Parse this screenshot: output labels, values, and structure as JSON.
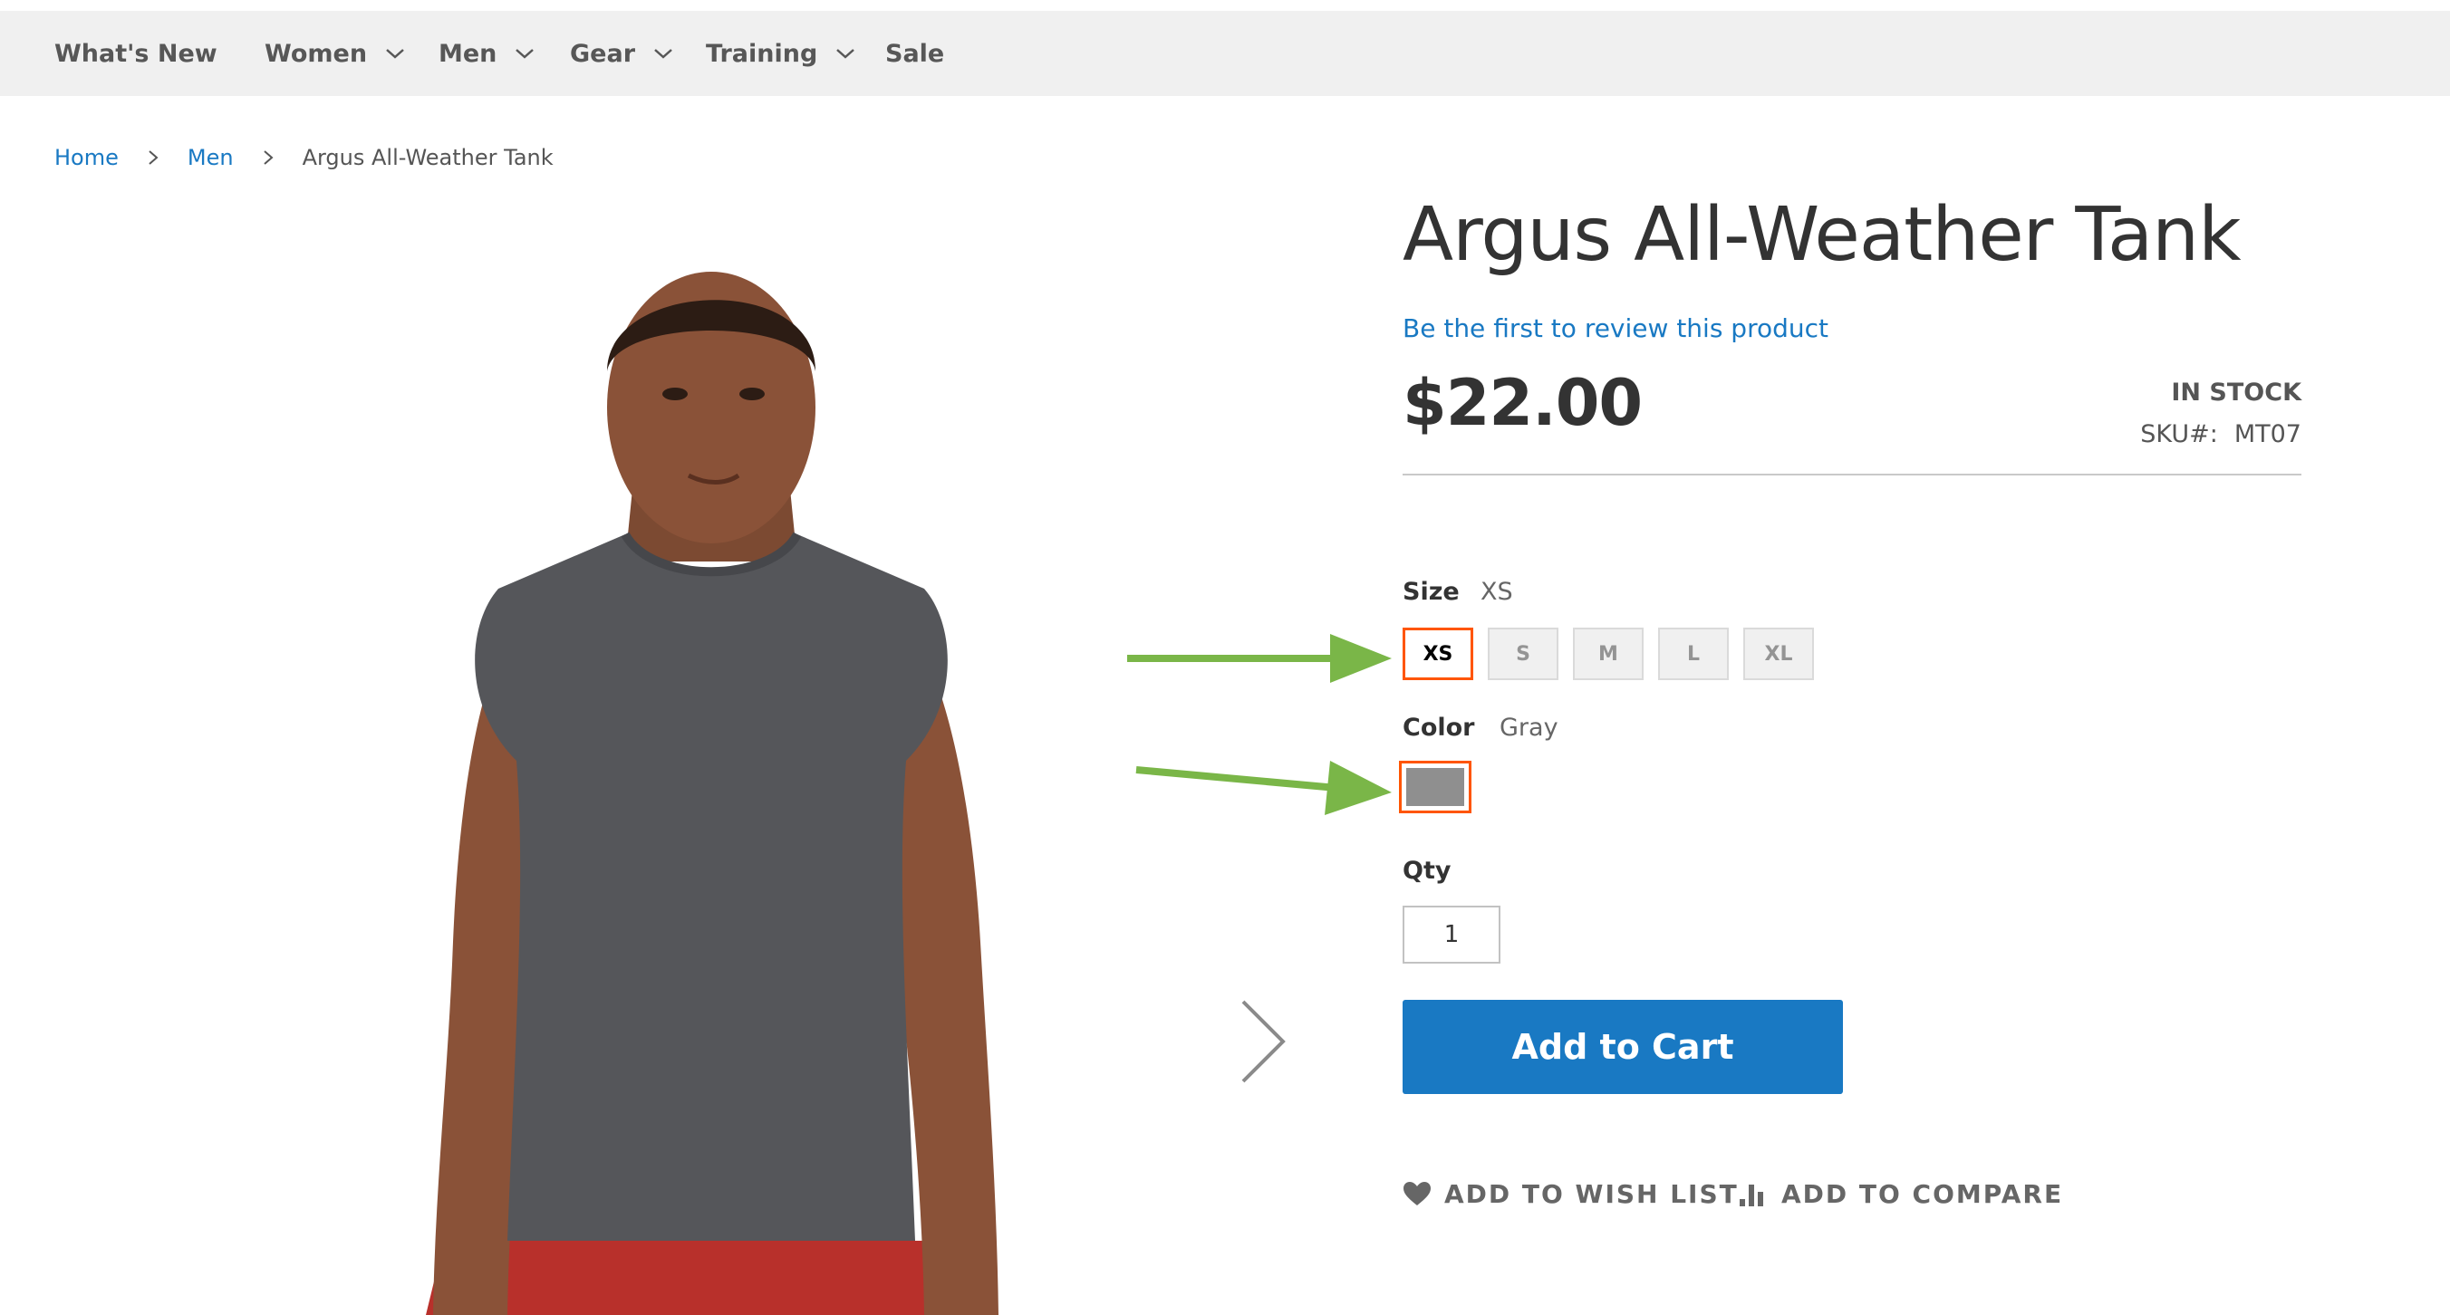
{
  "nav": {
    "items": [
      {
        "label": "What's New",
        "has_dropdown": false
      },
      {
        "label": "Women",
        "has_dropdown": true
      },
      {
        "label": "Men",
        "has_dropdown": true
      },
      {
        "label": "Gear",
        "has_dropdown": true
      },
      {
        "label": "Training",
        "has_dropdown": true
      },
      {
        "label": "Sale",
        "has_dropdown": false
      }
    ]
  },
  "breadcrumb": {
    "home": "Home",
    "category": "Men",
    "current": "Argus All-Weather Tank"
  },
  "product": {
    "title": "Argus All-Weather Tank",
    "review_link": "Be the first to review this product",
    "price": "$22.00",
    "stock": "IN STOCK",
    "sku_label": "SKU#:",
    "sku": "MT07"
  },
  "options": {
    "size": {
      "label": "Size",
      "selected": "XS",
      "choices": [
        "XS",
        "S",
        "M",
        "L",
        "XL"
      ]
    },
    "color": {
      "label": "Color",
      "selected": "Gray",
      "swatch_hex": "#8f8f8f"
    }
  },
  "qty": {
    "label": "Qty",
    "value": "1"
  },
  "cart_button": "Add to Cart",
  "actions": {
    "wishlist": "ADD TO WISH LIST",
    "compare": "ADD TO COMPARE"
  },
  "colors": {
    "nav_bg": "#f0f0f0",
    "link": "#1979c3",
    "primary_button": "#1979c3",
    "selected_outline": "#ff5501",
    "annotation_arrow": "#7ab648"
  }
}
